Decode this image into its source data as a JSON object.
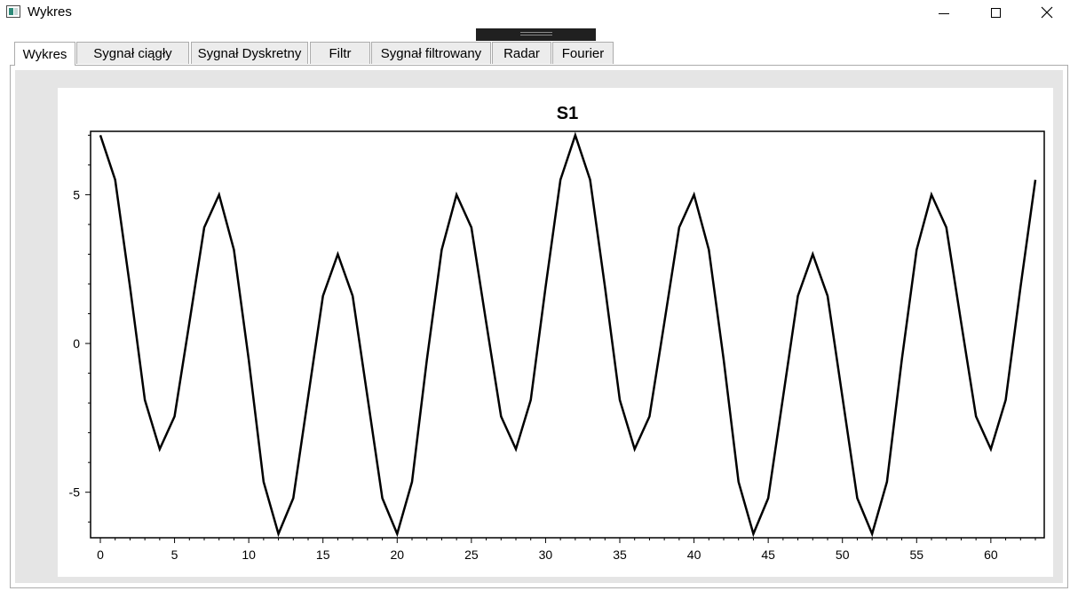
{
  "window": {
    "title": "Wykres",
    "icons": {
      "app": "app-window-icon",
      "minimize": "minimize-icon",
      "maximize": "maximize-icon",
      "close": "close-icon"
    }
  },
  "tabs": [
    {
      "label": "Wykres",
      "active": true
    },
    {
      "label": "Sygnał ciągły",
      "active": false
    },
    {
      "label": "Sygnał Dyskretny",
      "active": false
    },
    {
      "label": "Filtr",
      "active": false
    },
    {
      "label": "Sygnał filtrowany",
      "active": false
    },
    {
      "label": "Radar",
      "active": false
    },
    {
      "label": "Fourier",
      "active": false
    }
  ],
  "chart_data": {
    "type": "line",
    "title": "S1",
    "xlabel": "",
    "ylabel": "",
    "xlim": [
      0,
      63
    ],
    "ylim": [
      -6.5,
      7.1
    ],
    "xticks": [
      0,
      5,
      10,
      15,
      20,
      25,
      30,
      35,
      40,
      45,
      50,
      55,
      60
    ],
    "yticks": [
      -5,
      0,
      5
    ],
    "grid": false,
    "line_color": "#000000",
    "x": [
      0,
      1,
      2,
      3,
      4,
      5,
      6,
      7,
      8,
      9,
      10,
      11,
      12,
      13,
      14,
      15,
      16,
      17,
      18,
      19,
      20,
      21,
      22,
      23,
      24,
      25,
      26,
      27,
      28,
      29,
      30,
      31,
      32,
      33,
      34,
      35,
      36,
      37,
      38,
      39,
      40,
      41,
      42,
      43,
      44,
      45,
      46,
      47,
      48,
      49,
      50,
      51,
      52,
      53,
      54,
      55,
      56,
      57,
      58,
      59,
      60,
      61,
      62,
      63
    ],
    "series": [
      {
        "values": [
          7.0,
          5.5,
          1.9,
          -1.9,
          -3.55,
          -2.45,
          0.7,
          3.9,
          5.0,
          3.15,
          -0.55,
          -4.65,
          -6.4,
          -5.2,
          -1.8,
          1.6,
          3.0,
          1.6,
          -1.8,
          -5.2,
          -6.4,
          -4.65,
          -0.55,
          3.15,
          5.0,
          3.9,
          0.7,
          -2.45,
          -3.55,
          -1.9,
          1.9,
          5.5,
          7.0,
          5.5,
          1.9,
          -1.9,
          -3.55,
          -2.45,
          0.7,
          3.9,
          5.0,
          3.15,
          -0.55,
          -4.65,
          -6.4,
          -5.2,
          -1.8,
          1.6,
          3.0,
          1.6,
          -1.8,
          -5.2,
          -6.4,
          -4.65,
          -0.55,
          3.15,
          5.0,
          3.9,
          0.7,
          -2.45,
          -3.55,
          -1.9,
          1.9,
          5.5
        ]
      }
    ]
  }
}
